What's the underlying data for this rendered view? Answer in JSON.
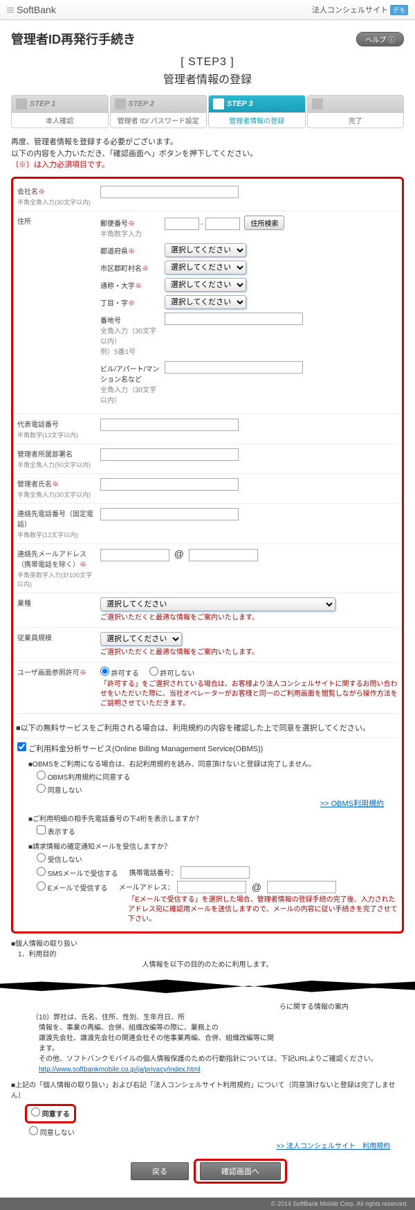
{
  "header": {
    "logo": "SoftBank",
    "site_name": "法人コンシェルサイト",
    "demo": "デモ"
  },
  "page_title": "管理者ID再発行手続き",
  "help_label": "ヘルプ ⓘ",
  "step_header": {
    "num": "[ STEP3 ]",
    "label": "管理者情報の登録"
  },
  "stepper": [
    {
      "code": "STEP 1",
      "label": "本人確認"
    },
    {
      "code": "STEP 2",
      "label": "管理者 ID/ パスワード設定"
    },
    {
      "code": "STEP 3",
      "label": "管理者情報の登録"
    },
    {
      "code": "",
      "label": "完了"
    }
  ],
  "intro_line1": "再度、管理者情報を登録する必要がございます。",
  "intro_line2": "以下の内容を入力いただき、「確認画面へ」ボタンを押下してください。",
  "intro_required": "（※）は入力必須項目です。",
  "company": {
    "label": "会社名",
    "hint": "半角全角入力(30文字以内)"
  },
  "address": {
    "label": "住所",
    "zip_label": "郵便番号",
    "zip_hint": "半角数字入力",
    "zip_search": "住所検索",
    "pref_label": "都道府県",
    "city_label": "市区郡町村名",
    "street_label": "通称・大字",
    "block_label": "丁目・字",
    "num_label": "番地号",
    "num_hint1": "全角入力（30文字以内）",
    "num_hint2": "例）5番1号",
    "bldg_label": "ビル/アパート/マンション名など",
    "bldg_hint": "全角入力（30文字以内）",
    "select_placeholder": "選択してください"
  },
  "tel": {
    "label": "代表電話番号",
    "hint": "半角数字(13文字以内)"
  },
  "dept": {
    "label": "管理者所属部署名",
    "hint": "半角全角入力(50文字以内)"
  },
  "name": {
    "label": "管理者氏名",
    "hint": "半角全角入力(30文字以内)"
  },
  "contact_tel": {
    "label": "連絡先電話番号（固定電話）",
    "hint": "半角数字(13文字以内)"
  },
  "email": {
    "label": "連絡先メールアドレス（携帯電話を除く）",
    "hint": "半角英数字入力(計100文字以内)",
    "at": "@"
  },
  "industry": {
    "label": "業種",
    "placeholder": "選択してください",
    "note": "ご選択いただくと最適な情報をご案内いたします。"
  },
  "scale": {
    "label": "従業員規模",
    "placeholder": "選択してください",
    "note": "ご選択いただくと最適な情報をご案内いたします。"
  },
  "permit": {
    "label": "ユーザ画面参照許可",
    "yes": "許可する",
    "no": "許可しない",
    "note": "「許可する」をご選択されている場合は、お客様より法人コンシェルサイトに関するお問い合わせをいただいた際に、当社オペレーターがお客様と同一のご利用画面を閲覧しながら操作方法をご説明させていただきます。"
  },
  "free_service_head": "■以下の無料サービスをご利用される場合は、利用規約の内容を確認した上で同意を選択してください。",
  "obms": {
    "title": "ご利用料金分析サービス(Online Billing Management Service(OBMS))",
    "note1": "■OBMSをご利用になる場合は、右記利用規約を読み、同意頂けないと登録は完了しません。",
    "opt1": "OBMS利用規約に同意する",
    "opt2": "同意しない",
    "link": ">> OBMS利用規約",
    "q2": "■ご利用明細の相手先電話番号の下4桁を表示しますか？",
    "q2_opt": "表示する",
    "q3": "■請求情報の確定通知メールを受信しますか？",
    "q3_opt1": "受信しない",
    "q3_opt2": "SMSメールで受信する",
    "q3_opt3": "Eメールで受信する",
    "mobile_label": "携帯電話番号：",
    "mail_label": "メールアドレス：",
    "at": "@",
    "mail_note": "「Eメールで受信する」を選択した場合、管理者情報の登録手続の完了後、入力されたアドレス宛に確認用メールを送信しますので、メールの内容に従い手続きを完了させて下さい。"
  },
  "privacy": {
    "head": "■個人情報の取り扱い",
    "purpose_head": "1．利用目的",
    "purpose_intro": "人情報を以下の目的のために利用します。",
    "item_suffix": "らに関する情報の案内",
    "item10": "（10）弊社は、氏名、住所、性別、生年月日、所",
    "para1": "情報を、事業の再編、合併、組織改編等の際に、業務上の",
    "para2": "譲渡先会社、譲渡先会社の関連会社その他事業再編、合併、組織改編等に関",
    "para3": "ます。",
    "para4": "その他、ソフトバンクモバイルの個人情報保護のための行動指針については、下記URLよりご確認ください。",
    "url": "http://www.softbankmobile.co.jp/ja/privacy/index.html"
  },
  "agree": {
    "head": "■上記の「個人情報の取り扱い」および右記「法人コンシェルサイト利用規約」について（同意頂けないと登録は完了しません）",
    "yes": "同意する",
    "no": "同意しない",
    "link": ">> 法人コンシェルサイト　利用規約"
  },
  "buttons": {
    "back": "戻る",
    "confirm": "確認画面へ"
  },
  "footer": "© 2014 SoftBank Mobile Corp. All rights reserved."
}
